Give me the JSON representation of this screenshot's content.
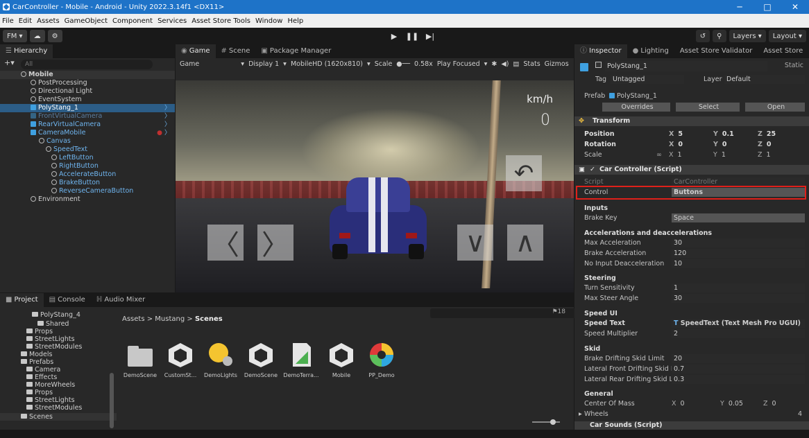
{
  "titlebar": {
    "title": "CarController - Mobile - Android - Unity 2022.3.14f1 <DX11>",
    "minimize": "─",
    "maximize": "□",
    "close": "✕"
  },
  "menubar": [
    "File",
    "Edit",
    "Assets",
    "GameObject",
    "Component",
    "Services",
    "Asset Store Tools",
    "Window",
    "Help"
  ],
  "toolbar": {
    "account": "FM ▾",
    "layers": "Layers",
    "layout": "Layout"
  },
  "hierarchy": {
    "tab": "Hierarchy",
    "search_placeholder": "All",
    "rows": [
      {
        "label": "Mobile",
        "depth": 1
      },
      {
        "label": "PostProcessing",
        "depth": 2
      },
      {
        "label": "Directional Light",
        "depth": 2
      },
      {
        "label": "EventSystem",
        "depth": 2
      },
      {
        "label": "PolyStang_1",
        "depth": 2
      },
      {
        "label": "FrontVirtualCamera",
        "depth": 2
      },
      {
        "label": "RearVirtualCamera",
        "depth": 2
      },
      {
        "label": "CameraMobile",
        "depth": 2
      },
      {
        "label": "Canvas",
        "depth": 3
      },
      {
        "label": "SpeedText",
        "depth": 4
      },
      {
        "label": "LeftButton",
        "depth": 4
      },
      {
        "label": "RightButton",
        "depth": 4
      },
      {
        "label": "AccelerateButton",
        "depth": 4
      },
      {
        "label": "BrakeButton",
        "depth": 4
      },
      {
        "label": "ReverseCameraButton",
        "depth": 4
      },
      {
        "label": "Environment",
        "depth": 2
      }
    ]
  },
  "game": {
    "tabs": [
      "Game",
      "Scene",
      "Package Manager"
    ],
    "sub": {
      "mode": "Game",
      "display": "Display 1",
      "resolution": "MobileHD (1620x810)",
      "scale_label": "Scale",
      "scale_value": "0.58x",
      "play_mode": "Play Focused",
      "stats": "Stats",
      "gizmos": "Gizmos"
    },
    "hud": {
      "unit": "km/h",
      "speed": "0"
    },
    "buttons": {
      "left": "〈",
      "right": "〉",
      "brake": "∨",
      "accelerate": "∧",
      "reverse": "↶"
    }
  },
  "project": {
    "tabs": [
      "Project",
      "Console",
      "Audio Mixer"
    ],
    "tree": [
      "PolyStang_4",
      "Shared",
      "Props",
      "StreetLights",
      "StreetModules",
      "Models",
      "Prefabs",
      "Camera",
      "Effects",
      "MoreWheels",
      "Props",
      "StreetLights",
      "StreetModules",
      "Scenes"
    ],
    "breadcrumb": {
      "a": "Assets",
      "b": "Mustang",
      "c": "Scenes"
    },
    "count": "18",
    "assets": [
      "DemoScene",
      "CustomSt...",
      "DemoLights",
      "DemoScene",
      "DemoTerra...",
      "Mobile",
      "PP_Demo"
    ]
  },
  "inspector": {
    "tabs": [
      "Inspector",
      "Lighting",
      "Asset Store Validator",
      "Asset Store"
    ],
    "object_name": "PolyStang_1",
    "static": "Static",
    "tag_label": "Tag",
    "tag": "Untagged",
    "layer_label": "Layer",
    "layer": "Default",
    "prefab_label": "Prefab",
    "prefab": "PolyStang_1",
    "overrides": "Overrides",
    "select": "Select",
    "open": "Open",
    "transform": {
      "title": "Transform",
      "position": {
        "label": "Position",
        "x": "5",
        "y": "0.1",
        "z": "25"
      },
      "rotation": {
        "label": "Rotation",
        "x": "0",
        "y": "0",
        "z": "0"
      },
      "scale": {
        "label": "Scale",
        "x": "1",
        "y": "1",
        "z": "1"
      }
    },
    "car_controller": {
      "title": "Car Controller (Script)",
      "script_label": "Script",
      "script": "CarController",
      "control_label": "Control",
      "control": "Buttons",
      "inputs": "Inputs",
      "brake_key_label": "Brake Key",
      "brake_key": "Space",
      "accel_header": "Accelerations and deaccelerations",
      "max_accel_label": "Max Acceleration",
      "max_accel": "30",
      "brake_accel_label": "Brake Acceleration",
      "brake_accel": "120",
      "no_input_label": "No Input Deacceleration",
      "no_input": "10",
      "steering": "Steering",
      "turn_label": "Turn Sensitivity",
      "turn": "1",
      "max_steer_label": "Max Steer Angle",
      "max_steer": "30",
      "speed_ui": "Speed UI",
      "speed_text_label": "Speed Text",
      "speed_text": "SpeedText (Text Mesh Pro UGUI)",
      "speed_mult_label": "Speed Multiplier",
      "speed_mult": "2",
      "skid": "Skid",
      "brake_skid_label": "Brake Drifting Skid Limit",
      "brake_skid": "20",
      "lat_front_label": "Lateral Front Drifting Skid Lin",
      "lat_front": "0.7",
      "lat_rear_label": "Lateral Rear Drifting Skid Lim",
      "lat_rear": "0.3",
      "general": "General",
      "com_label": "Center Of Mass",
      "com_x": "0",
      "com_y": "0.05",
      "com_z": "0",
      "wheels_label": "Wheels",
      "wheels": "4"
    },
    "car_sounds": "Car Sounds (Script)"
  }
}
